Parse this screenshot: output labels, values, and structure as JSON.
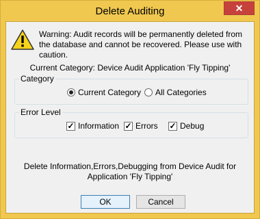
{
  "window": {
    "title": "Delete Auditing",
    "close_glyph": "✕"
  },
  "warning": {
    "icon": "warning-icon",
    "text": "Warning: Audit records will be permanently deleted from the database and cannot be recovered. Please use with caution."
  },
  "current_category": "Current Category: Device Audit Application 'Fly Tipping'",
  "category_group": {
    "label": "Category",
    "options": [
      {
        "label": "Current Category",
        "selected": true
      },
      {
        "label": "All Categories",
        "selected": false
      }
    ]
  },
  "error_group": {
    "label": "Error Level",
    "options": [
      {
        "label": "Information",
        "checked": true
      },
      {
        "label": "Errors",
        "checked": true
      },
      {
        "label": "Debug",
        "checked": true
      }
    ]
  },
  "summary": "Delete Information,Errors,Debugging from Device Audit for Application 'Fly Tipping'",
  "buttons": {
    "ok": "OK",
    "cancel": "Cancel"
  },
  "colors": {
    "title_bar": "#f0c850",
    "close": "#c7413c",
    "body": "#f0f0f0"
  }
}
